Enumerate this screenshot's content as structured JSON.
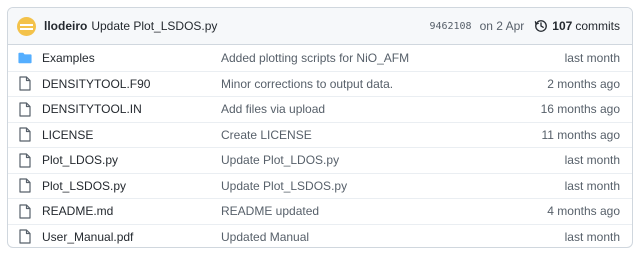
{
  "header": {
    "author": "llodeiro",
    "commit_message": "Update Plot_LSDOS.py",
    "sha": "9462108",
    "date": "on 2 Apr",
    "commit_count": "107",
    "commits_label": "commits",
    "avatar_color": "#f3c24a"
  },
  "files": [
    {
      "name": "Examples",
      "type": "folder",
      "icon": "folder-icon",
      "message": "Added plotting scripts for NiO_AFM",
      "age": "last month"
    },
    {
      "name": "DENSITYTOOL.F90",
      "type": "file",
      "icon": "file-icon",
      "message": "Minor corrections to output data.",
      "age": "2 months ago"
    },
    {
      "name": "DENSITYTOOL.IN",
      "type": "file",
      "icon": "file-icon",
      "message": "Add files via upload",
      "age": "16 months ago"
    },
    {
      "name": "LICENSE",
      "type": "file",
      "icon": "file-icon",
      "message": "Create LICENSE",
      "age": "11 months ago"
    },
    {
      "name": "Plot_LDOS.py",
      "type": "file",
      "icon": "file-icon",
      "message": "Update Plot_LDOS.py",
      "age": "last month"
    },
    {
      "name": "Plot_LSDOS.py",
      "type": "file",
      "icon": "file-icon",
      "message": "Update Plot_LSDOS.py",
      "age": "last month"
    },
    {
      "name": "README.md",
      "type": "file",
      "icon": "file-icon",
      "message": "README updated",
      "age": "4 months ago"
    },
    {
      "name": "User_Manual.pdf",
      "type": "file",
      "icon": "file-icon",
      "message": "Updated Manual",
      "age": "last month"
    }
  ],
  "colors": {
    "folder": "#54aeff",
    "border": "#d0d7de",
    "header_bg": "#f6f8fa",
    "muted_text": "#57606a"
  }
}
